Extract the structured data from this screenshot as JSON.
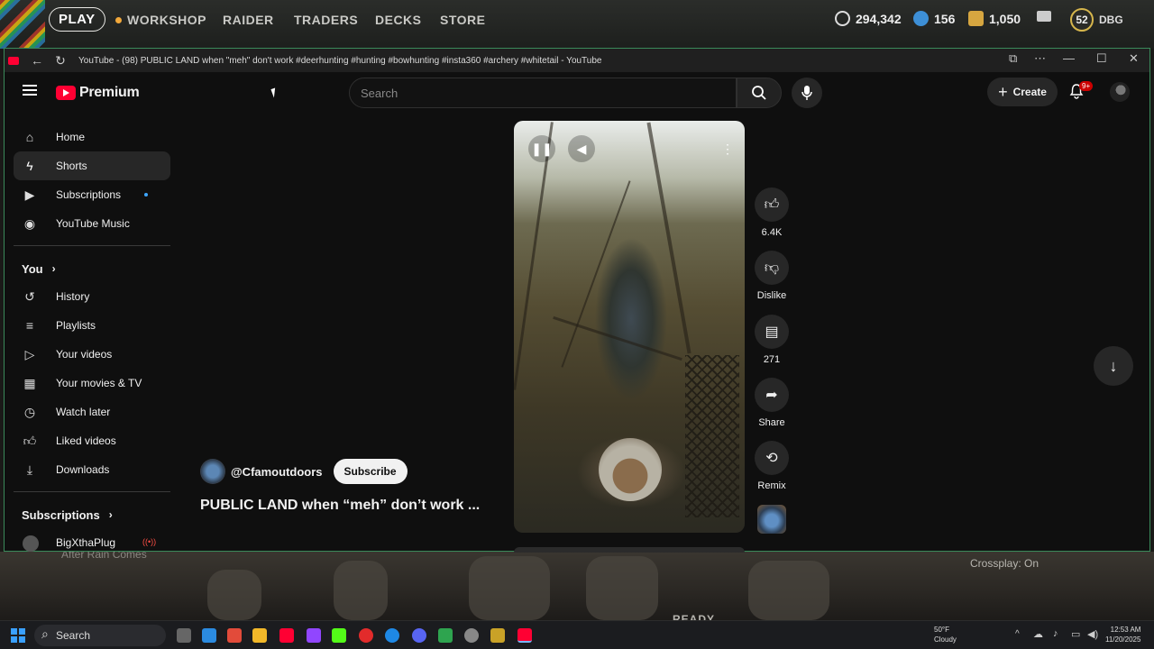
{
  "game": {
    "play_label": "PLAY",
    "nav": [
      "WORKSHOP",
      "RAIDER",
      "TRADERS",
      "DECKS",
      "STORE"
    ],
    "currency1": "294,342",
    "currency2": "156",
    "currency3": "1,050",
    "level": "52",
    "player": "DBG",
    "crossplay": "Crossplay: On",
    "bg_text": "After Rain Comes",
    "ready_text": "READY"
  },
  "browser": {
    "title": "YouTube - (98) PUBLIC LAND when \"meh\" don't work #deerhunting #hunting #bowhunting #insta360 #archery #whitetail - YouTube"
  },
  "youtube": {
    "logo_text": "Premium",
    "search_placeholder": "Search",
    "create_label": "Create",
    "notif_badge": "9+",
    "sidebar": {
      "main": [
        "Home",
        "Shorts",
        "Subscriptions",
        "YouTube Music"
      ],
      "you_heading": "You",
      "you_items": [
        "History",
        "Playlists",
        "Your videos",
        "Your movies & TV",
        "Watch later",
        "Liked videos",
        "Downloads"
      ],
      "subs_heading": "Subscriptions",
      "subs_items": [
        "BigXthaPlug"
      ]
    },
    "short": {
      "channel": "@Cfamoutdoors",
      "subscribe_label": "Subscribe",
      "title": "PUBLIC LAND when “meh” don’t work ...",
      "likes": "6.4K",
      "dislike_label": "Dislike",
      "comments": "271",
      "share_label": "Share",
      "remix_label": "Remix"
    }
  },
  "taskbar": {
    "search_placeholder": "Search",
    "weather_temp": "50°F",
    "weather_desc": "Cloudy",
    "time": "12:53 AM",
    "date": "11/20/2025"
  }
}
